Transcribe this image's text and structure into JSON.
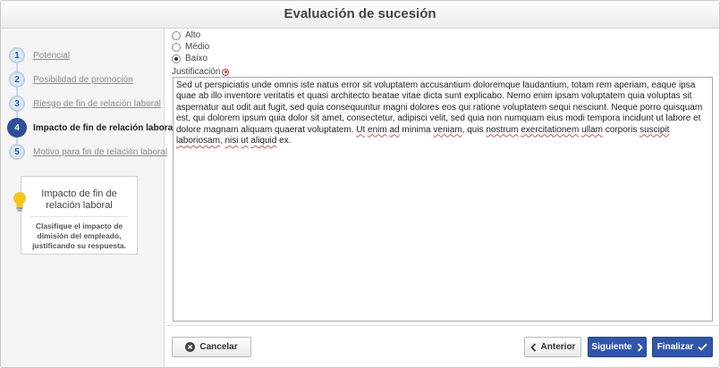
{
  "window": {
    "title": "Evaluación de sucesión"
  },
  "steps": [
    {
      "number": "1",
      "label": "Potencial",
      "active": false
    },
    {
      "number": "2",
      "label": "Posibilidad de promoción",
      "active": false
    },
    {
      "number": "3",
      "label": "Riesgo de fin de relación laboral",
      "active": false
    },
    {
      "number": "4",
      "label": "Impacto de fin de relación laboral",
      "active": true
    },
    {
      "number": "5",
      "label": "Motivo para fin de relación laboral",
      "active": false
    }
  ],
  "info_box": {
    "title": "Impacto de fin de relación laboral",
    "text": "Clasifique el impacto de dimisión del empleado, justificando su respuesta."
  },
  "impact_options": {
    "items": [
      "Alto",
      "Médio",
      "Baixo"
    ],
    "selected": "Baixo"
  },
  "justification": {
    "label": "Justificación",
    "required": true,
    "segments": [
      {
        "text": "Sed ut perspiciatis unde omnis iste natus error sit voluptatem accusantium doloremque laudantium, totam rem aperiam, eaque ipsa quae ab illo inventore veritatis et quasi architecto beatae vitae dicta sunt explicabo. Nemo enim ipsam voluptatem quia voluptas sit aspernatur aut odit aut fugit, sed quia consequuntur magni dolores eos qui ratione voluptatem sequi nesciunt. Neque porro quisquam est, qui dolorem ipsum quia dolor sit amet, consectetur, adipisci velit, sed quia non numquam eius modi tempora incidunt ut labore et dolore magnam aliquam quaerat voluptatem. ",
        "misspelled": false
      },
      {
        "text": "Ut",
        "misspelled": true
      },
      {
        "text": " ",
        "misspelled": false
      },
      {
        "text": "enim",
        "misspelled": true
      },
      {
        "text": " ",
        "misspelled": false
      },
      {
        "text": "ad",
        "misspelled": true
      },
      {
        "text": " minima ",
        "misspelled": false
      },
      {
        "text": "veniam",
        "misspelled": true
      },
      {
        "text": ", quis ",
        "misspelled": false
      },
      {
        "text": "nostrum",
        "misspelled": true
      },
      {
        "text": " ",
        "misspelled": false
      },
      {
        "text": "exercitationem",
        "misspelled": true
      },
      {
        "text": " ",
        "misspelled": false
      },
      {
        "text": "ullam",
        "misspelled": true
      },
      {
        "text": " corporis ",
        "misspelled": false
      },
      {
        "text": "suscipit",
        "misspelled": true
      },
      {
        "text": " ",
        "misspelled": false
      },
      {
        "text": "laboriosam",
        "misspelled": true
      },
      {
        "text": ", ",
        "misspelled": false
      },
      {
        "text": "nisi",
        "misspelled": true
      },
      {
        "text": " ",
        "misspelled": false
      },
      {
        "text": "ut",
        "misspelled": true
      },
      {
        "text": " ",
        "misspelled": false
      },
      {
        "text": "aliquid",
        "misspelled": true
      },
      {
        "text": " ex.",
        "misspelled": false
      }
    ]
  },
  "buttons": {
    "cancel": "Cancelar",
    "previous": "Anterior",
    "next": "Siguiente",
    "finish": "Finalizar"
  },
  "colors": {
    "primary": "#2f55ad",
    "active_step": "#2c4f98",
    "required": "#d9302c",
    "bulb": "#f5c518"
  }
}
